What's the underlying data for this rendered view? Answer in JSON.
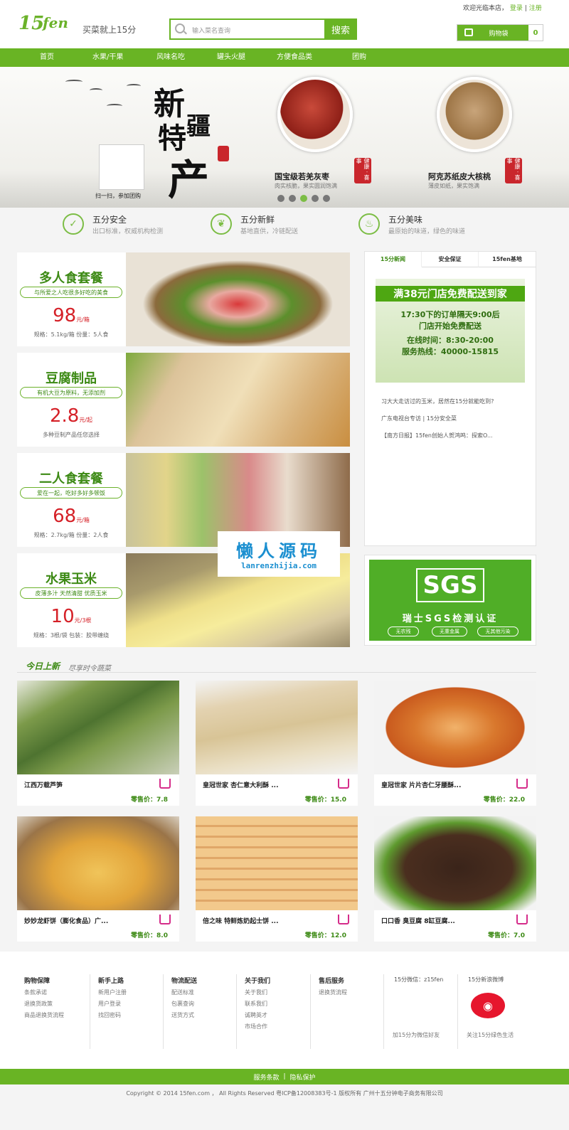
{
  "header": {
    "logo_num": "15",
    "logo_fen": "fen",
    "slogan": "买菜就上15分",
    "search_placeholder": "输入菜名查询",
    "search_button": "搜索",
    "welcome": "欢迎光临本店，",
    "login": "登录",
    "sep": "|",
    "register": "注册",
    "cart_label": "购物袋",
    "cart_count": "0"
  },
  "nav": [
    "首页",
    "水果/干果",
    "风味名吃",
    "罐头火腿",
    "方便食品类",
    "团购"
  ],
  "banner": {
    "title_a": "新",
    "title_b": "疆",
    "title_c": "特",
    "title_d": "产",
    "qr_caption": "扫一扫，参加团购",
    "seal_text": "健康 · 喜事",
    "product1_name": "国宝级若羌灰枣",
    "product1_desc": "肉实核脆，果实圆润饱满",
    "product2_name": "阿克苏纸皮大核桃",
    "product2_desc": "薄皮如纸，果实饱满",
    "active_dot": 2
  },
  "features": [
    {
      "title": "五分安全",
      "sub": "出口标准，权威机构检测"
    },
    {
      "title": "五分新鲜",
      "sub": "基地直供，冷链配送"
    },
    {
      "title": "五分美味",
      "sub": "最原始的味道，绿色的味道"
    }
  ],
  "promos": [
    {
      "title": "多人食套餐",
      "slogan": "与所爱之人吃很多好吃的美食",
      "price": "98",
      "unit": "元/箱",
      "spec": "规格：5.1kg/箱  份量：5人食"
    },
    {
      "title": "豆腐制品",
      "slogan": "有机大豆为原料，无添加剂",
      "price": "2.8",
      "unit": "元/起",
      "spec": "多种豆制产品任您选择"
    },
    {
      "title": "二人食套餐",
      "slogan": "爱在一起，吃好多好多顿饭",
      "price": "68",
      "unit": "元/箱",
      "spec": "规格：2.7kg/箱  份量：2人食"
    },
    {
      "title": "水果玉米",
      "slogan": "皮薄多汁  天然清甜  优质玉米",
      "price": "10",
      "unit": "元/3根",
      "spec": "规格：3根/袋  包装：胶带缠绕"
    }
  ],
  "side": {
    "tabs": [
      "15分新闻",
      "安全保证",
      "15fen基地"
    ],
    "banner_head": "满38元门店免费配送到家",
    "banner_l1": "17:30下的订单隔天9:00后",
    "banner_l2": "门店开始免费配送",
    "banner_l3": "在线时间：8:30-20:00",
    "banner_l4": "服务热线：40000-15815",
    "news": [
      "习大大走访过的玉米，居然在15分就能吃到?",
      "广东电视台专访 | 15分安全菜",
      "【南方日报】15fen创始人贺鸿鸣：探索O..."
    ]
  },
  "sgs": {
    "logo": "SGS",
    "cert": "瑞士SGS检测认证",
    "tags": [
      "无农残",
      "无重金属",
      "无其他污染"
    ]
  },
  "watermark": {
    "cn": "懒人源码",
    "url": "lanrenzhijia.com"
  },
  "section": {
    "title": "今日上新",
    "sub": "尽享时令蔬菜"
  },
  "goods": [
    {
      "name": "江西万载芦笋",
      "price": "零售价：7.8"
    },
    {
      "name": "皇冠世家 杏仁意大利酥 ...",
      "price": "零售价：15.0"
    },
    {
      "name": "皇冠世家 片片杏仁牙腰酥...",
      "price": "零售价：22.0"
    },
    {
      "name": "妙妙龙虾饼（膨化食品）广...",
      "price": "零售价：8.0"
    },
    {
      "name": "倍之味 特鲜炼奶起士饼 ...",
      "price": "零售价：12.0"
    },
    {
      "name": "口口香 臭豆腐 8缸豆腐...",
      "price": "零售价：7.0"
    }
  ],
  "footer": {
    "cols": [
      {
        "h": "购物保障",
        "items": [
          "条款承诺",
          "退换货政策",
          "商品退换货流程"
        ]
      },
      {
        "h": "新手上路",
        "items": [
          "新用户注册",
          "用户登录",
          "找回密码"
        ]
      },
      {
        "h": "物流配送",
        "items": [
          "配送标准",
          "包裹查询",
          "送货方式"
        ]
      },
      {
        "h": "关于我们",
        "items": [
          "关于我们",
          "联系我们",
          "诚聘英才",
          "市场合作"
        ]
      },
      {
        "h": "售后服务",
        "items": [
          "退换货流程"
        ]
      }
    ],
    "wechat_title": "15分微信：z15fen",
    "wechat_caption": "加15分为微信好友",
    "weibo_title": "15分新浪微博",
    "weibo_caption": "关注15分绿色生活",
    "bar_terms": "服务条款",
    "bar_sep": "|",
    "bar_privacy": "隐私保护",
    "copyright": "Copyright © 2014 15fen.com  ， All Rights Reserved 粤ICP备12008383号-1 版权所有 广州十五分钟电子商务有限公司"
  },
  "colors": {
    "brand": "#69b424",
    "price": "#d52027",
    "dark_green": "#3d8a15"
  }
}
